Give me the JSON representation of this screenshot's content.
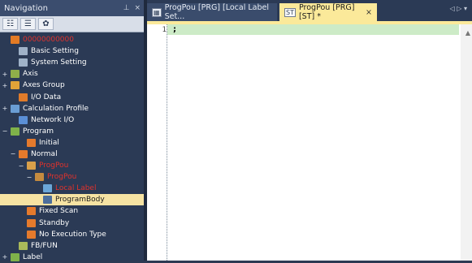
{
  "navigation": {
    "title": "Navigation",
    "pin": "⊥",
    "close": "×",
    "toolbar": [
      "☷",
      "☰",
      "✿"
    ],
    "tree": [
      {
        "indent": 0,
        "exp": "",
        "label": "00000000000",
        "color": "#e0322c",
        "icon_color": "#e37b25",
        "red": true
      },
      {
        "indent": 1,
        "exp": "",
        "label": "Basic Setting",
        "icon_color": "#9fb2c8",
        "red": false
      },
      {
        "indent": 1,
        "exp": "",
        "label": "System Setting",
        "icon_color": "#9fb2c8",
        "red": false
      },
      {
        "indent": 0,
        "exp": "+",
        "label": "Axis",
        "icon_color": "#8fae4a",
        "red": false
      },
      {
        "indent": 0,
        "exp": "+",
        "label": "Axes Group",
        "icon_color": "#e2a338",
        "red": false
      },
      {
        "indent": 1,
        "exp": "",
        "label": "I/O Data",
        "icon_color": "#e07b2a",
        "red": false
      },
      {
        "indent": 0,
        "exp": "+",
        "label": "Calculation Profile",
        "icon_color": "#6a9dd4",
        "red": false
      },
      {
        "indent": 1,
        "exp": "",
        "label": "Network I/O",
        "icon_color": "#5b8fd6",
        "red": false
      },
      {
        "indent": 0,
        "exp": "−",
        "label": "Program",
        "icon_color": "#7fb24a",
        "red": false
      },
      {
        "indent": 2,
        "exp": "",
        "label": "Initial",
        "icon_color": "#e57a2c",
        "red": false
      },
      {
        "indent": 1,
        "exp": "−",
        "label": "Normal",
        "icon_color": "#e57a2c",
        "red": false
      },
      {
        "indent": 2,
        "exp": "−",
        "label": "ProgPou",
        "icon_color": "#d9a04a",
        "red": true
      },
      {
        "indent": 3,
        "exp": "−",
        "label": "ProgPou",
        "icon_color": "#c58b3f",
        "red": true
      },
      {
        "indent": 4,
        "exp": "",
        "label": "Local Label",
        "icon_color": "#6aa6d8",
        "red": true
      },
      {
        "indent": 4,
        "exp": "",
        "label": "ProgramBody",
        "icon_color": "#4d6f9c",
        "red": false,
        "selected": true
      },
      {
        "indent": 2,
        "exp": "",
        "label": "Fixed Scan",
        "icon_color": "#e57a2c",
        "red": false
      },
      {
        "indent": 2,
        "exp": "",
        "label": "Standby",
        "icon_color": "#e57a2c",
        "red": false
      },
      {
        "indent": 2,
        "exp": "",
        "label": "No Execution Type",
        "icon_color": "#e57a2c",
        "red": false
      },
      {
        "indent": 1,
        "exp": "",
        "label": "FB/FUN",
        "icon_color": "#a9b95a",
        "red": false
      },
      {
        "indent": 0,
        "exp": "+",
        "label": "Label",
        "icon_color": "#7fb24a",
        "red": false
      }
    ]
  },
  "editor": {
    "tabs": [
      {
        "label": "ProgPou [PRG] [Local Label Set...",
        "icon": "▦",
        "active": false
      },
      {
        "label": "ProgPou [PRG] [ST] *",
        "icon": "ST",
        "active": true,
        "close": "×"
      }
    ],
    "tab_controls": "◁ ▷ ▾",
    "line_number": "1",
    "code": ";"
  }
}
